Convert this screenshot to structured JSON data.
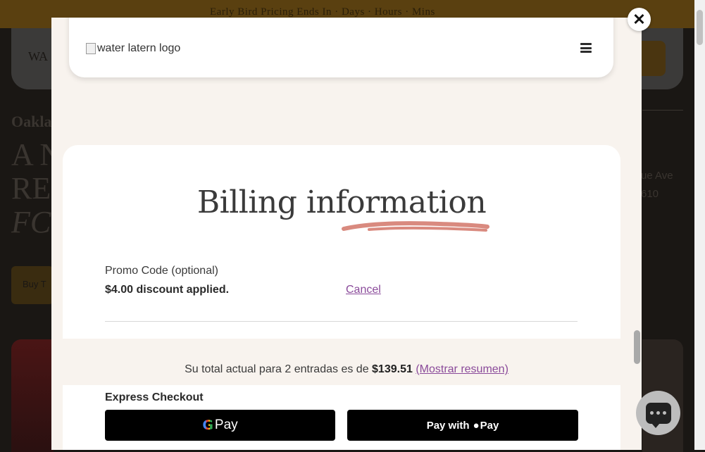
{
  "background": {
    "topbar_text": "Early Bird Pricing Ends In  ·  Days  ·  Hours  ·  Mins",
    "nav_text": "WA",
    "city": "Oakla",
    "hero_line1": "A N",
    "hero_line2": "RE",
    "hero_line3": "FC",
    "address_line1": "ue Ave",
    "address_line2": "610",
    "buy_button": "Buy T"
  },
  "modal": {
    "logo_alt": "water latern logo",
    "menu_icon": "hamburger-icon",
    "close_label": "✕",
    "billing": {
      "title": "Billing information",
      "promo_label": "Promo Code (optional)",
      "discount_text": "$4.00 discount applied.",
      "cancel_label": "Cancel"
    },
    "total": {
      "prefix": "Su total actual para 2 entradas es de ",
      "amount": "$139.51",
      "summary_link": "(Mostrar resumen)"
    },
    "express": {
      "label": "Express Checkout",
      "gpay_g": "G",
      "gpay_word": "Pay",
      "apple_pay_prefix": "Pay with",
      "apple_pay_word": "Pay"
    }
  },
  "colors": {
    "accent_link": "#8a4a9a",
    "brush": "#d98a7f",
    "modal_bg": "#f8f3ee"
  },
  "chat": {
    "icon": "chat-icon"
  }
}
